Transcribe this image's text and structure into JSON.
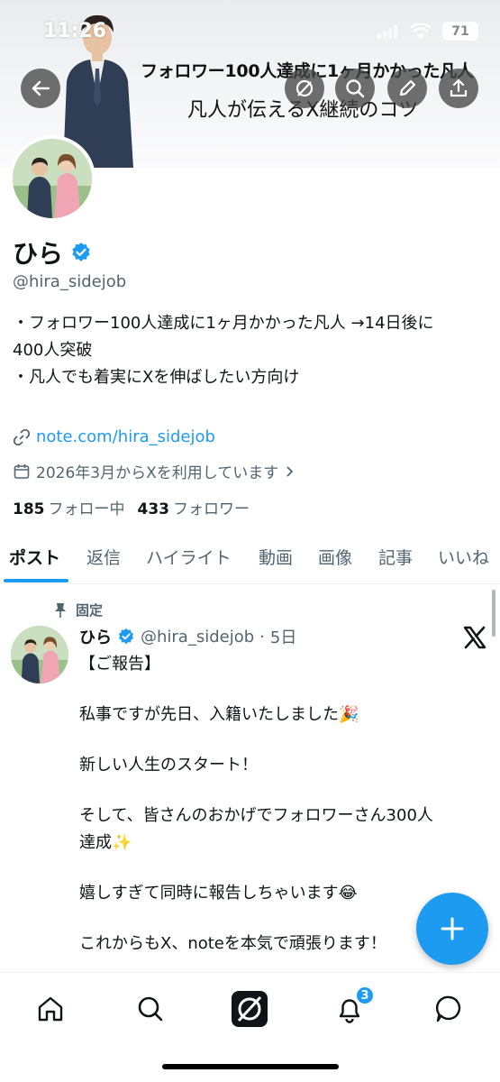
{
  "status_bar": {
    "time": "11:26",
    "battery": "71"
  },
  "banner": {
    "line1": "フォロワー100人達成に1ヶ月かかった凡人",
    "line2": "凡人が伝えるX継続のコツ"
  },
  "header_buttons": {
    "back": "back-arrow-icon",
    "grok": "grok-icon",
    "search": "search-icon",
    "edit": "pencil-icon",
    "share": "share-icon"
  },
  "profile": {
    "name": "ひら",
    "handle": "@hira_sidejob",
    "bio": [
      "・フォロワー100人達成に1ヶ月かかった凡人 →14日後に",
      "400人突破",
      "・凡人でも着実にXを伸ばしたい方向け"
    ],
    "link": "note.com/hira_sidejob",
    "joined": "2026年3月からXを利用しています",
    "following_count": "185",
    "following_label": "フォロー中",
    "followers_count": "433",
    "followers_label": "フォロワー"
  },
  "tabs": [
    "ポスト",
    "返信",
    "ハイライト",
    "動画",
    "画像",
    "記事",
    "いいね"
  ],
  "pinned_tweet": {
    "pinned_label": "固定",
    "name": "ひら",
    "handle": "@hira_sidejob",
    "dot": "·",
    "time": "5日",
    "lines": [
      "【ご報告】",
      "",
      "私事ですが先日、入籍いたしました🎉",
      "",
      "新しい人生のスタート！",
      "",
      "そして、皆さんのおかげでフォロワーさん300人",
      "達成✨",
      "",
      "嬉しすぎて同時に報告しちゃいます😂",
      "",
      "これからもX、noteを本気で頑張ります！"
    ]
  },
  "bottom_nav": {
    "notifications_badge": "3"
  },
  "colors": {
    "accent": "#1d9bf0",
    "text": "#0f1419",
    "muted": "#536471"
  }
}
